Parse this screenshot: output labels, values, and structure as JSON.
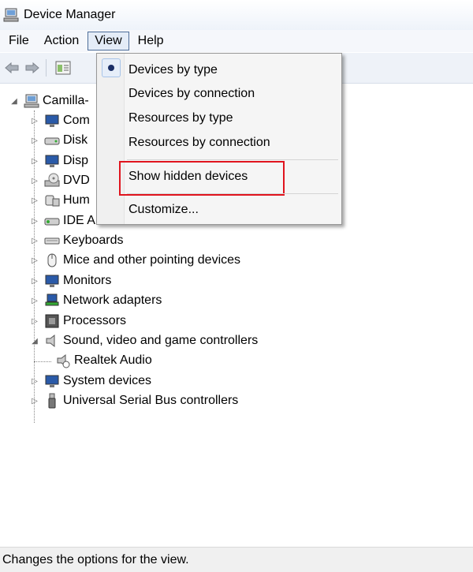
{
  "window": {
    "title": "Device Manager"
  },
  "menubar": {
    "items": [
      "File",
      "Action",
      "View",
      "Help"
    ]
  },
  "view_menu": {
    "items": [
      {
        "label": "Devices by type",
        "checked": true
      },
      {
        "label": "Devices by connection"
      },
      {
        "label": "Resources by type"
      },
      {
        "label": "Resources by connection"
      },
      {
        "label": "Show hidden devices",
        "highlighted": true
      },
      {
        "label": "Customize..."
      }
    ]
  },
  "tree": {
    "root": "Camilla-",
    "items": [
      "Com",
      "Disk",
      "Disp",
      "DVD",
      "Hum",
      "IDE A",
      "Keyboards",
      "Mice and other pointing devices",
      "Monitors",
      "Network adapters",
      "Processors",
      "Sound, video and game controllers",
      "Realtek Audio",
      "System devices",
      "Universal Serial Bus controllers"
    ]
  },
  "status": {
    "text": "Changes the options for the view."
  },
  "colors": {
    "highlight_box": "#e0141e",
    "menu_active_border": "#4e6d99"
  },
  "icons": [
    "device-manager-icon",
    "back-arrow-icon",
    "forward-arrow-icon",
    "properties-icon",
    "computer-icon",
    "monitor-icon",
    "disk-icon",
    "dvd-icon",
    "hid-icon",
    "ide-icon",
    "keyboard-icon",
    "mouse-icon",
    "network-icon",
    "processor-icon",
    "speaker-icon",
    "usb-icon"
  ]
}
